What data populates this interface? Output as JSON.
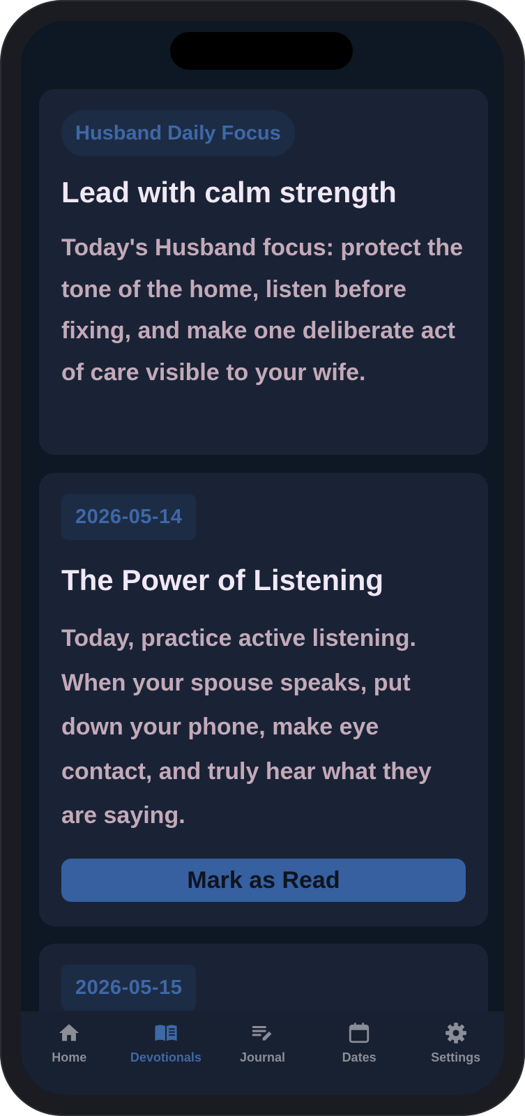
{
  "cards": [
    {
      "chip": "Husband Daily Focus",
      "title": "Lead with calm strength",
      "body": "Today's Husband focus: protect the tone of the home, listen before fixing, and make one deliberate act of care visible to your wife."
    },
    {
      "chip": "2026-05-14",
      "title": "The Power of Listening",
      "body": "Today, practice active listening. When your spouse speaks, put down your phone, make eye contact, and truly hear what they are saying.",
      "button": "Mark as Read"
    },
    {
      "chip": "2026-05-15"
    }
  ],
  "nav": {
    "active": "devotionals",
    "items": [
      {
        "label": "Home",
        "icon": "home-icon"
      },
      {
        "label": "Devotionals",
        "icon": "book-icon"
      },
      {
        "label": "Journal",
        "icon": "journal-edit-icon"
      },
      {
        "label": "Dates",
        "icon": "calendar-icon"
      },
      {
        "label": "Settings",
        "icon": "gear-icon"
      }
    ]
  },
  "colors": {
    "background": "#0d1824",
    "card": "#1a2336",
    "accent": "#3e68a6",
    "title": "#f1e8f5",
    "body": "#c3aab9",
    "button": "#3660a0",
    "nav_inactive": "#8b8d98"
  }
}
